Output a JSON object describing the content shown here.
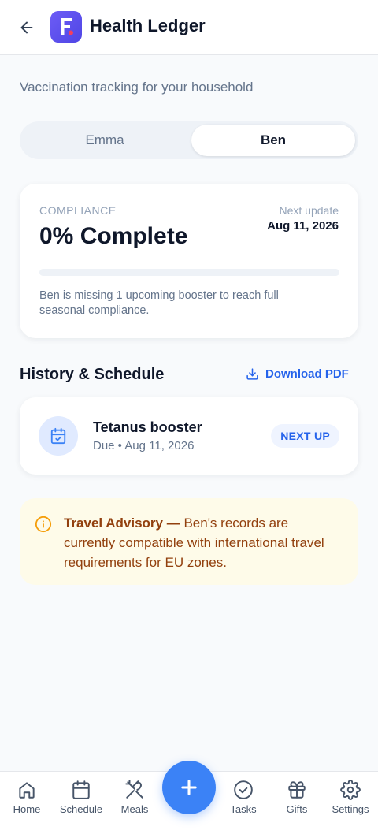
{
  "header": {
    "title": "Health Ledger",
    "logo_letter": "F"
  },
  "subtitle": "Vaccination tracking for your household",
  "tabs": [
    {
      "label": "Emma",
      "active": false
    },
    {
      "label": "Ben",
      "active": true
    }
  ],
  "compliance": {
    "label": "COMPLIANCE",
    "value": "0% Complete",
    "progress_fraction": 0,
    "next_update_label": "Next update",
    "next_update_date": "Aug 11, 2026",
    "message": "Ben is missing 1 upcoming booster to reach full seasonal compliance."
  },
  "history": {
    "title": "History & Schedule",
    "download_label": "Download PDF",
    "items": [
      {
        "title": "Tetanus booster",
        "due": "Due • Aug 11, 2026",
        "badge": "NEXT UP"
      }
    ]
  },
  "advisory": {
    "title": "Travel Advisory —",
    "text": " Ben's records are currently compatible with international travel requirements for EU zones."
  },
  "nav": {
    "items": [
      {
        "label": "Home",
        "icon": "home-icon"
      },
      {
        "label": "Schedule",
        "icon": "calendar-icon"
      },
      {
        "label": "Meals",
        "icon": "utensils-icon"
      },
      {
        "label": "Tasks",
        "icon": "check-circle-icon"
      },
      {
        "label": "Gifts",
        "icon": "gift-icon"
      },
      {
        "label": "Settings",
        "icon": "gear-icon"
      }
    ],
    "fab_icon": "plus-icon"
  },
  "colors": {
    "accent": "#3b82f6",
    "logo": "#5b4ff0",
    "advisory_bg": "#fefbe9",
    "advisory_text": "#92400e"
  }
}
